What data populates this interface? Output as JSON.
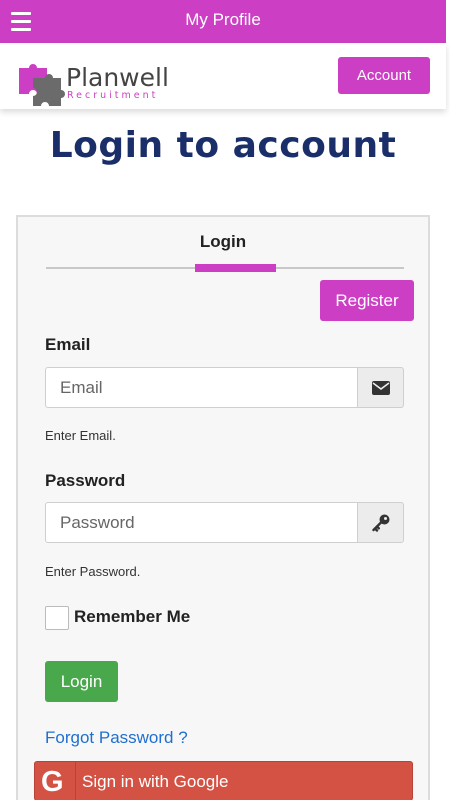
{
  "topbar": {
    "title": "My Profile",
    "menu_icon": "hamburger-icon"
  },
  "header": {
    "logo_name": "Planwell",
    "logo_sub": "Recruitment",
    "account_label": "Account"
  },
  "page_title": "Login to account",
  "tabs": {
    "login_label": "Login"
  },
  "register_label": "Register",
  "email": {
    "label": "Email",
    "placeholder": "Email",
    "help": "Enter Email.",
    "icon": "envelope-icon"
  },
  "password": {
    "label": "Password",
    "placeholder": "Password",
    "help": "Enter Password.",
    "icon": "key-icon"
  },
  "remember_label": "Remember Me",
  "login_label": "Login",
  "forgot_label": "Forgot Password ?",
  "google": {
    "icon_letter": "G",
    "label": "Sign in with Google"
  },
  "colors": {
    "brand": "#cc3fc4",
    "title": "#1a2e6a",
    "success": "#4aa84c",
    "link": "#1f6fd0",
    "google": "#d45243"
  }
}
